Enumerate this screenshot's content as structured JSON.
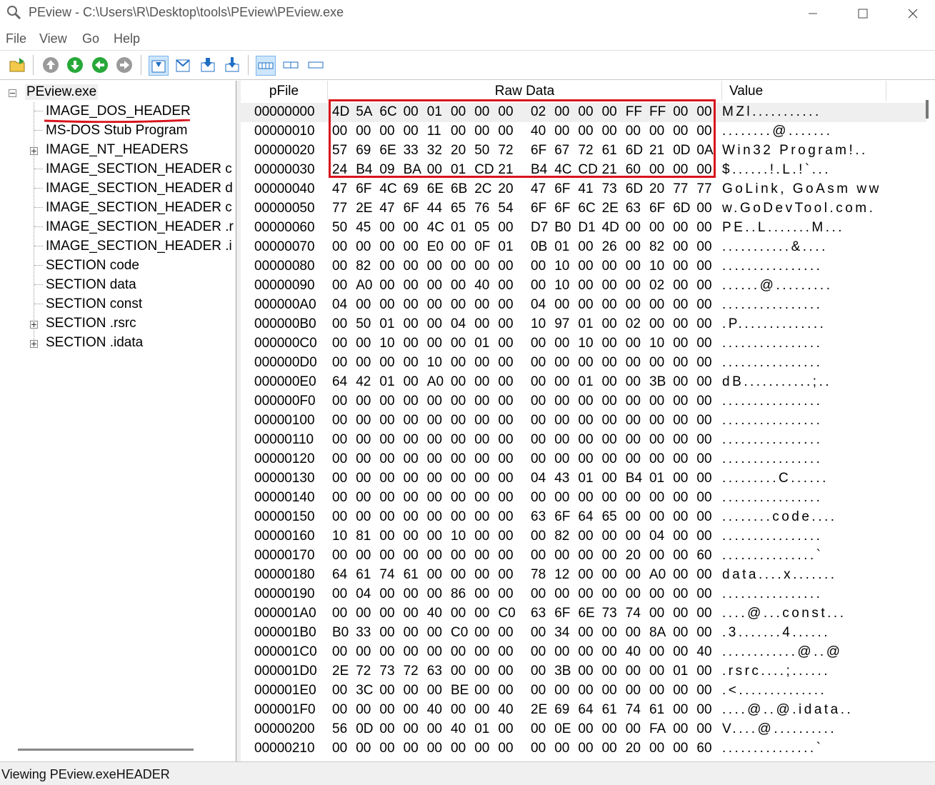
{
  "window": {
    "title": "PEview - C:\\Users\\R\\Desktop\\tools\\PEview\\PEview.exe"
  },
  "menu": [
    "File",
    "View",
    "Go",
    "Help"
  ],
  "tree": {
    "root": "PEview.exe",
    "items": [
      "IMAGE_DOS_HEADER",
      "MS-DOS Stub Program",
      "IMAGE_NT_HEADERS",
      "IMAGE_SECTION_HEADER c",
      "IMAGE_SECTION_HEADER d",
      "IMAGE_SECTION_HEADER c",
      "IMAGE_SECTION_HEADER .r",
      "IMAGE_SECTION_HEADER .i",
      "SECTION code",
      "SECTION data",
      "SECTION const",
      "SECTION .rsrc",
      "SECTION .idata"
    ]
  },
  "columns": {
    "pfile": "pFile",
    "raw": "Raw Data",
    "value": "Value"
  },
  "rows": [
    {
      "off": "00000000",
      "bytes": [
        "4D",
        "5A",
        "6C",
        "00",
        "01",
        "00",
        "00",
        "00",
        "02",
        "00",
        "00",
        "00",
        "FF",
        "FF",
        "00",
        "00"
      ],
      "val": "MZl..........."
    },
    {
      "off": "00000010",
      "bytes": [
        "00",
        "00",
        "00",
        "00",
        "11",
        "00",
        "00",
        "00",
        "40",
        "00",
        "00",
        "00",
        "00",
        "00",
        "00",
        "00"
      ],
      "val": "........@......."
    },
    {
      "off": "00000020",
      "bytes": [
        "57",
        "69",
        "6E",
        "33",
        "32",
        "20",
        "50",
        "72",
        "6F",
        "67",
        "72",
        "61",
        "6D",
        "21",
        "0D",
        "0A"
      ],
      "val": "Win32 Program!.."
    },
    {
      "off": "00000030",
      "bytes": [
        "24",
        "B4",
        "09",
        "BA",
        "00",
        "01",
        "CD",
        "21",
        "B4",
        "4C",
        "CD",
        "21",
        "60",
        "00",
        "00",
        "00"
      ],
      "val": "$......!.L.!`..."
    },
    {
      "off": "00000040",
      "bytes": [
        "47",
        "6F",
        "4C",
        "69",
        "6E",
        "6B",
        "2C",
        "20",
        "47",
        "6F",
        "41",
        "73",
        "6D",
        "20",
        "77",
        "77"
      ],
      "val": "GoLink, GoAsm ww"
    },
    {
      "off": "00000050",
      "bytes": [
        "77",
        "2E",
        "47",
        "6F",
        "44",
        "65",
        "76",
        "54",
        "6F",
        "6F",
        "6C",
        "2E",
        "63",
        "6F",
        "6D",
        "00"
      ],
      "val": "w.GoDevTool.com."
    },
    {
      "off": "00000060",
      "bytes": [
        "50",
        "45",
        "00",
        "00",
        "4C",
        "01",
        "05",
        "00",
        "D7",
        "B0",
        "D1",
        "4D",
        "00",
        "00",
        "00",
        "00"
      ],
      "val": "PE..L.......M..."
    },
    {
      "off": "00000070",
      "bytes": [
        "00",
        "00",
        "00",
        "00",
        "E0",
        "00",
        "0F",
        "01",
        "0B",
        "01",
        "00",
        "26",
        "00",
        "82",
        "00",
        "00"
      ],
      "val": "...........&...."
    },
    {
      "off": "00000080",
      "bytes": [
        "00",
        "82",
        "00",
        "00",
        "00",
        "00",
        "00",
        "00",
        "00",
        "10",
        "00",
        "00",
        "00",
        "10",
        "00",
        "00"
      ],
      "val": "................"
    },
    {
      "off": "00000090",
      "bytes": [
        "00",
        "A0",
        "00",
        "00",
        "00",
        "00",
        "40",
        "00",
        "00",
        "10",
        "00",
        "00",
        "00",
        "02",
        "00",
        "00"
      ],
      "val": "......@........."
    },
    {
      "off": "000000A0",
      "bytes": [
        "04",
        "00",
        "00",
        "00",
        "00",
        "00",
        "00",
        "00",
        "04",
        "00",
        "00",
        "00",
        "00",
        "00",
        "00",
        "00"
      ],
      "val": "................"
    },
    {
      "off": "000000B0",
      "bytes": [
        "00",
        "50",
        "01",
        "00",
        "00",
        "04",
        "00",
        "00",
        "10",
        "97",
        "01",
        "00",
        "02",
        "00",
        "00",
        "00"
      ],
      "val": ".P.............."
    },
    {
      "off": "000000C0",
      "bytes": [
        "00",
        "00",
        "10",
        "00",
        "00",
        "00",
        "01",
        "00",
        "00",
        "00",
        "10",
        "00",
        "00",
        "10",
        "00",
        "00"
      ],
      "val": "................"
    },
    {
      "off": "000000D0",
      "bytes": [
        "00",
        "00",
        "00",
        "00",
        "10",
        "00",
        "00",
        "00",
        "00",
        "00",
        "00",
        "00",
        "00",
        "00",
        "00",
        "00"
      ],
      "val": "................"
    },
    {
      "off": "000000E0",
      "bytes": [
        "64",
        "42",
        "01",
        "00",
        "A0",
        "00",
        "00",
        "00",
        "00",
        "00",
        "01",
        "00",
        "00",
        "3B",
        "00",
        "00"
      ],
      "val": "dB...........;.."
    },
    {
      "off": "000000F0",
      "bytes": [
        "00",
        "00",
        "00",
        "00",
        "00",
        "00",
        "00",
        "00",
        "00",
        "00",
        "00",
        "00",
        "00",
        "00",
        "00",
        "00"
      ],
      "val": "................"
    },
    {
      "off": "00000100",
      "bytes": [
        "00",
        "00",
        "00",
        "00",
        "00",
        "00",
        "00",
        "00",
        "00",
        "00",
        "00",
        "00",
        "00",
        "00",
        "00",
        "00"
      ],
      "val": "................"
    },
    {
      "off": "00000110",
      "bytes": [
        "00",
        "00",
        "00",
        "00",
        "00",
        "00",
        "00",
        "00",
        "00",
        "00",
        "00",
        "00",
        "00",
        "00",
        "00",
        "00"
      ],
      "val": "................"
    },
    {
      "off": "00000120",
      "bytes": [
        "00",
        "00",
        "00",
        "00",
        "00",
        "00",
        "00",
        "00",
        "00",
        "00",
        "00",
        "00",
        "00",
        "00",
        "00",
        "00"
      ],
      "val": "................"
    },
    {
      "off": "00000130",
      "bytes": [
        "00",
        "00",
        "00",
        "00",
        "00",
        "00",
        "00",
        "00",
        "04",
        "43",
        "01",
        "00",
        "B4",
        "01",
        "00",
        "00"
      ],
      "val": ".........C......"
    },
    {
      "off": "00000140",
      "bytes": [
        "00",
        "00",
        "00",
        "00",
        "00",
        "00",
        "00",
        "00",
        "00",
        "00",
        "00",
        "00",
        "00",
        "00",
        "00",
        "00"
      ],
      "val": "................"
    },
    {
      "off": "00000150",
      "bytes": [
        "00",
        "00",
        "00",
        "00",
        "00",
        "00",
        "00",
        "00",
        "63",
        "6F",
        "64",
        "65",
        "00",
        "00",
        "00",
        "00"
      ],
      "val": "........code...."
    },
    {
      "off": "00000160",
      "bytes": [
        "10",
        "81",
        "00",
        "00",
        "00",
        "10",
        "00",
        "00",
        "00",
        "82",
        "00",
        "00",
        "00",
        "04",
        "00",
        "00"
      ],
      "val": "................"
    },
    {
      "off": "00000170",
      "bytes": [
        "00",
        "00",
        "00",
        "00",
        "00",
        "00",
        "00",
        "00",
        "00",
        "00",
        "00",
        "00",
        "20",
        "00",
        "00",
        "60"
      ],
      "val": "...............`"
    },
    {
      "off": "00000180",
      "bytes": [
        "64",
        "61",
        "74",
        "61",
        "00",
        "00",
        "00",
        "00",
        "78",
        "12",
        "00",
        "00",
        "00",
        "A0",
        "00",
        "00"
      ],
      "val": "data....x......."
    },
    {
      "off": "00000190",
      "bytes": [
        "00",
        "04",
        "00",
        "00",
        "00",
        "86",
        "00",
        "00",
        "00",
        "00",
        "00",
        "00",
        "00",
        "00",
        "00",
        "00"
      ],
      "val": "................"
    },
    {
      "off": "000001A0",
      "bytes": [
        "00",
        "00",
        "00",
        "00",
        "40",
        "00",
        "00",
        "C0",
        "63",
        "6F",
        "6E",
        "73",
        "74",
        "00",
        "00",
        "00"
      ],
      "val": "....@...const..."
    },
    {
      "off": "000001B0",
      "bytes": [
        "B0",
        "33",
        "00",
        "00",
        "00",
        "C0",
        "00",
        "00",
        "00",
        "34",
        "00",
        "00",
        "00",
        "8A",
        "00",
        "00"
      ],
      "val": ".3.......4......"
    },
    {
      "off": "000001C0",
      "bytes": [
        "00",
        "00",
        "00",
        "00",
        "00",
        "00",
        "00",
        "00",
        "00",
        "00",
        "00",
        "00",
        "40",
        "00",
        "00",
        "40"
      ],
      "val": "............@..@"
    },
    {
      "off": "000001D0",
      "bytes": [
        "2E",
        "72",
        "73",
        "72",
        "63",
        "00",
        "00",
        "00",
        "00",
        "3B",
        "00",
        "00",
        "00",
        "00",
        "01",
        "00"
      ],
      "val": ".rsrc....;......"
    },
    {
      "off": "000001E0",
      "bytes": [
        "00",
        "3C",
        "00",
        "00",
        "00",
        "BE",
        "00",
        "00",
        "00",
        "00",
        "00",
        "00",
        "00",
        "00",
        "00",
        "00"
      ],
      "val": ".<.............."
    },
    {
      "off": "000001F0",
      "bytes": [
        "00",
        "00",
        "00",
        "00",
        "40",
        "00",
        "00",
        "40",
        "2E",
        "69",
        "64",
        "61",
        "74",
        "61",
        "00",
        "00"
      ],
      "val": "....@..@.idata.."
    },
    {
      "off": "00000200",
      "bytes": [
        "56",
        "0D",
        "00",
        "00",
        "00",
        "40",
        "01",
        "00",
        "00",
        "0E",
        "00",
        "00",
        "00",
        "FA",
        "00",
        "00"
      ],
      "val": "V....@.........."
    },
    {
      "off": "00000210",
      "bytes": [
        "00",
        "00",
        "00",
        "00",
        "00",
        "00",
        "00",
        "00",
        "00",
        "00",
        "00",
        "00",
        "20",
        "00",
        "00",
        "60"
      ],
      "val": "...............`"
    }
  ],
  "status": "Viewing PEview.exeHEADER"
}
